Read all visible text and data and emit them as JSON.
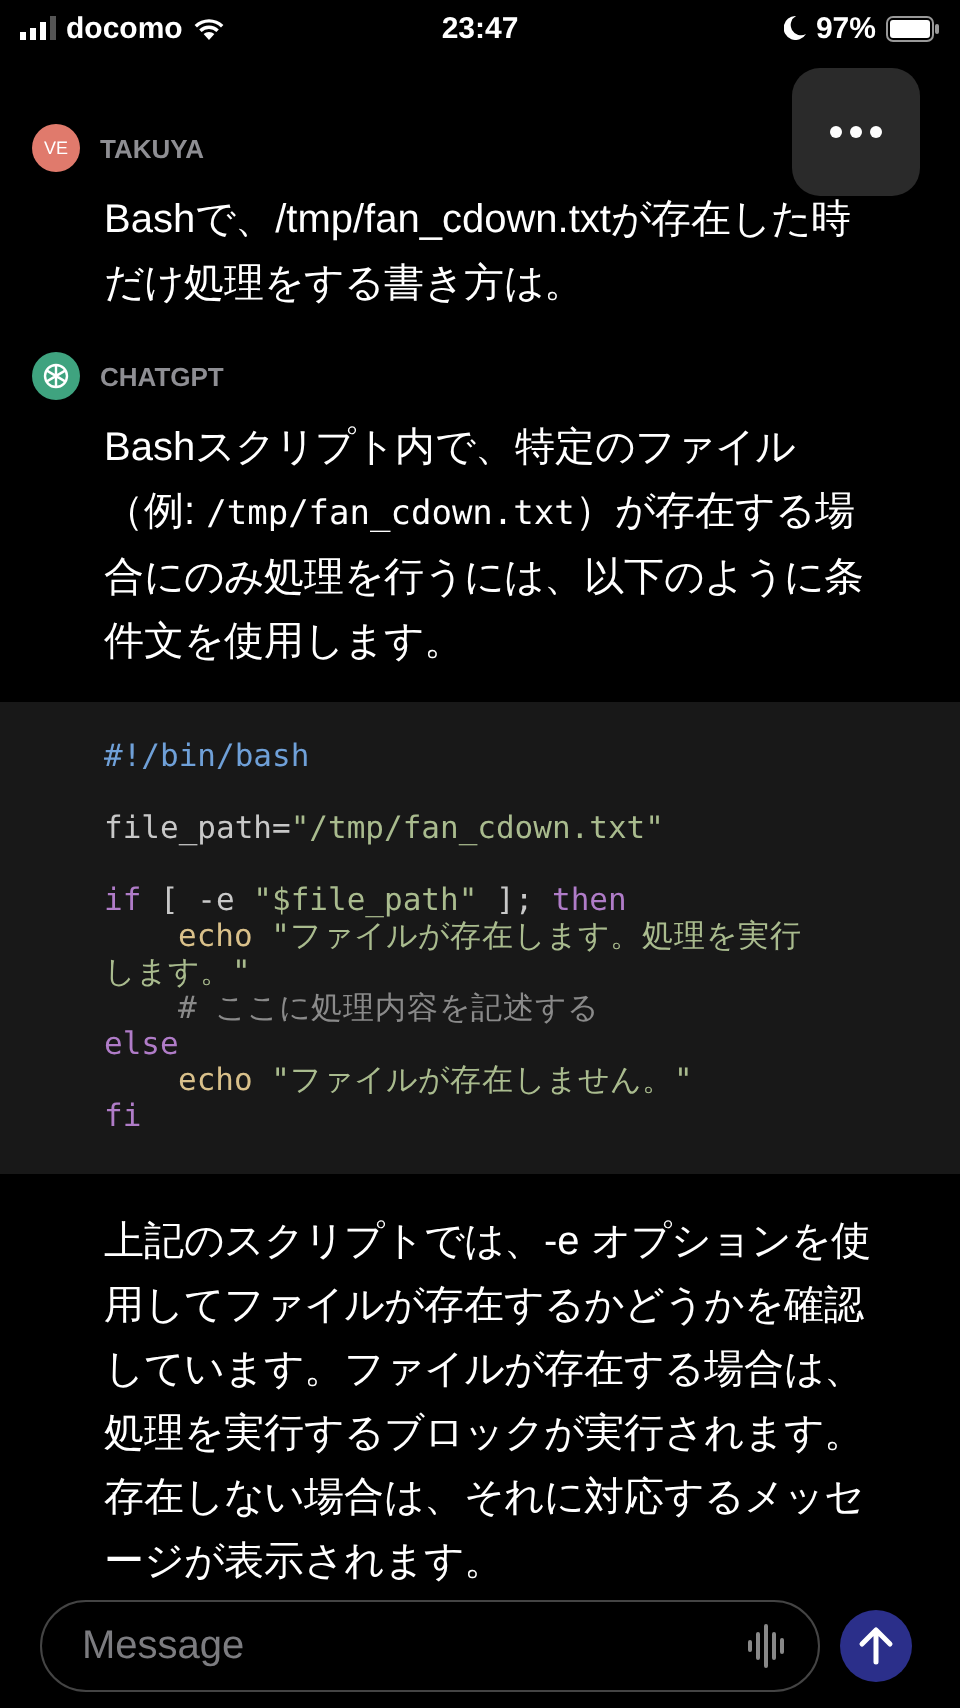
{
  "status_bar": {
    "carrier": "docomo",
    "time": "23:47",
    "battery": "97%"
  },
  "messages": [
    {
      "author": "TAKUYA",
      "avatar": "VE",
      "kind": "user",
      "paragraphs": [
        [
          {
            "text": "Bashで、/tmp/fan_cdown.txtが存在した時だけ処理をする書き方は。",
            "code": false
          }
        ]
      ]
    },
    {
      "author": "CHATGPT",
      "kind": "assistant",
      "paragraphs": [
        [
          {
            "text": "Bashスクリプト内で、特定のファイル（例: ",
            "code": false
          },
          {
            "text": "/tmp/fan_cdown.txt",
            "code": true
          },
          {
            "text": "）が存在する場合にのみ処理を行うには、以下のように条件文を使用します。",
            "code": false
          }
        ]
      ],
      "code_lines": [
        {
          "kind": "code",
          "indent": false,
          "tokens": [
            {
              "text": "#!/bin/bash",
              "kind": "shebang"
            }
          ]
        },
        {
          "kind": "blank"
        },
        {
          "kind": "code",
          "indent": false,
          "tokens": [
            {
              "text": "file_path=",
              "kind": "plain"
            },
            {
              "text": "\"/tmp/fan_cdown.txt\"",
              "kind": "string"
            }
          ]
        },
        {
          "kind": "blank"
        },
        {
          "kind": "code",
          "indent": false,
          "tokens": [
            {
              "text": "if",
              "kind": "keyword"
            },
            {
              "text": " [ -e ",
              "kind": "plain"
            },
            {
              "text": "\"$file_path\"",
              "kind": "string"
            },
            {
              "text": " ]; ",
              "kind": "plain"
            },
            {
              "text": "then",
              "kind": "keyword"
            }
          ]
        },
        {
          "kind": "code",
          "indent": true,
          "tokens": [
            {
              "text": "echo",
              "kind": "builtin"
            },
            {
              "text": " \"ファイルが存在します。処理を実行します。\"",
              "kind": "string"
            }
          ]
        },
        {
          "kind": "code",
          "indent": true,
          "tokens": [
            {
              "text": "# ここに処理内容を記述する",
              "kind": "comment"
            }
          ]
        },
        {
          "kind": "code",
          "indent": false,
          "tokens": [
            {
              "text": "else",
              "kind": "keyword"
            }
          ]
        },
        {
          "kind": "code",
          "indent": true,
          "tokens": [
            {
              "text": "echo",
              "kind": "builtin"
            },
            {
              "text": " \"ファイルが存在しません。\"",
              "kind": "string"
            }
          ]
        },
        {
          "kind": "code",
          "indent": false,
          "tokens": [
            {
              "text": "fi",
              "kind": "keyword"
            }
          ]
        }
      ],
      "after": "上記のスクリプトでは、-e オプションを使用してファイルが存在するかどうかを確認しています。ファイルが存在する場合は、処理を実行するブロックが実行されます。存在しない場合は、それに対応するメッセージが表示されます。"
    }
  ],
  "composer": {
    "placeholder": "Message"
  }
}
